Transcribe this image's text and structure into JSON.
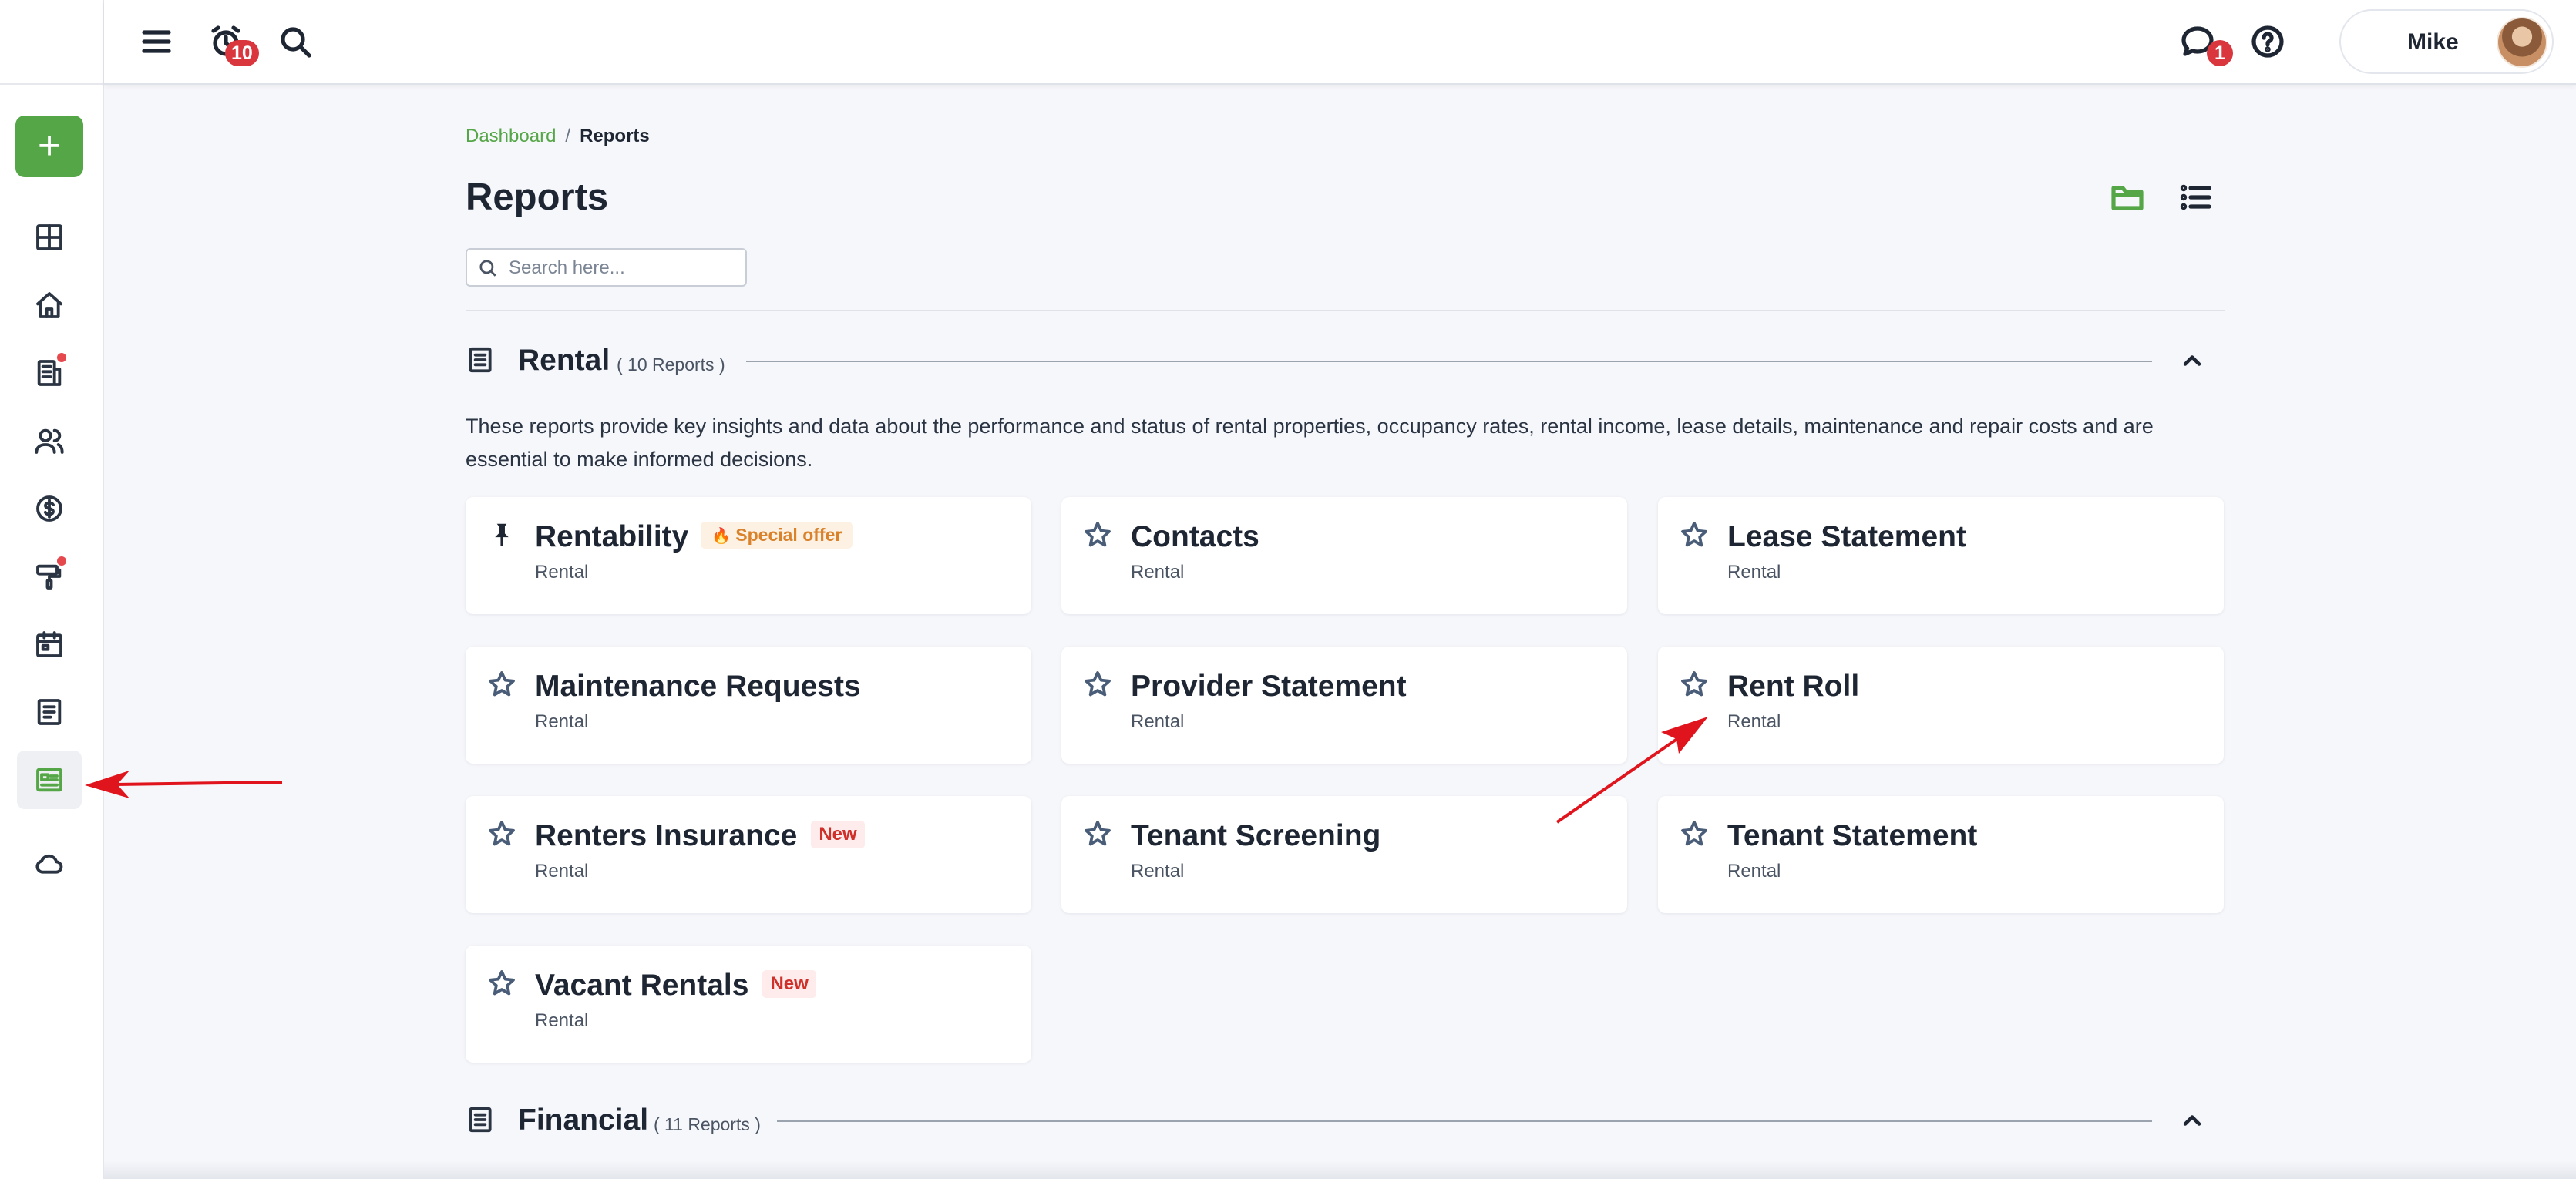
{
  "topbar": {
    "notifications_count": "10",
    "messages_count": "1",
    "user_name": "Mike"
  },
  "breadcrumb": {
    "link": "Dashboard",
    "separator": "/",
    "current": "Reports"
  },
  "page": {
    "title": "Reports",
    "search_placeholder": "Search here..."
  },
  "sections": [
    {
      "title": "Rental",
      "count_label": "( 10 Reports )",
      "description": "These reports provide key insights and data about the performance and status of rental properties, occupancy rates, rental income, lease details, maintenance and repair costs and are essential to make informed decisions.",
      "cards": [
        {
          "title": "Rentability",
          "subtitle": "Rental",
          "badge": "Special offer",
          "pinned": true
        },
        {
          "title": "Contacts",
          "subtitle": "Rental"
        },
        {
          "title": "Lease Statement",
          "subtitle": "Rental"
        },
        {
          "title": "Maintenance Requests",
          "subtitle": "Rental"
        },
        {
          "title": "Provider Statement",
          "subtitle": "Rental"
        },
        {
          "title": "Rent Roll",
          "subtitle": "Rental"
        },
        {
          "title": "Renters Insurance",
          "subtitle": "Rental",
          "badge": "New"
        },
        {
          "title": "Tenant Screening",
          "subtitle": "Rental"
        },
        {
          "title": "Tenant Statement",
          "subtitle": "Rental"
        },
        {
          "title": "Vacant Rentals",
          "subtitle": "Rental",
          "badge": "New"
        }
      ]
    },
    {
      "title": "Financial",
      "count_label": "( 11 Reports )"
    }
  ],
  "colors": {
    "accent": "#55a647",
    "badge_red": "#d9363e",
    "annotation_arrow": "#e0141c"
  }
}
